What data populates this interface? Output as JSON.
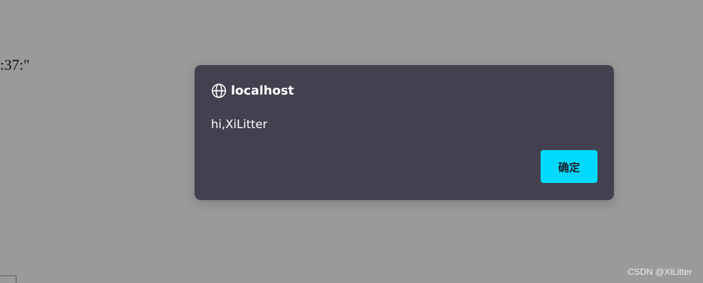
{
  "background": {
    "partial_text": ":37:\"",
    "color": "#9a999b"
  },
  "dialog": {
    "icon": "globe-icon",
    "title": "localhost",
    "message": "hi,XiLitter",
    "ok_label": "确定",
    "background_color": "#43414f",
    "accent_color": "#00d9ff"
  },
  "watermark": {
    "text": "CSDN @XiLitter"
  }
}
